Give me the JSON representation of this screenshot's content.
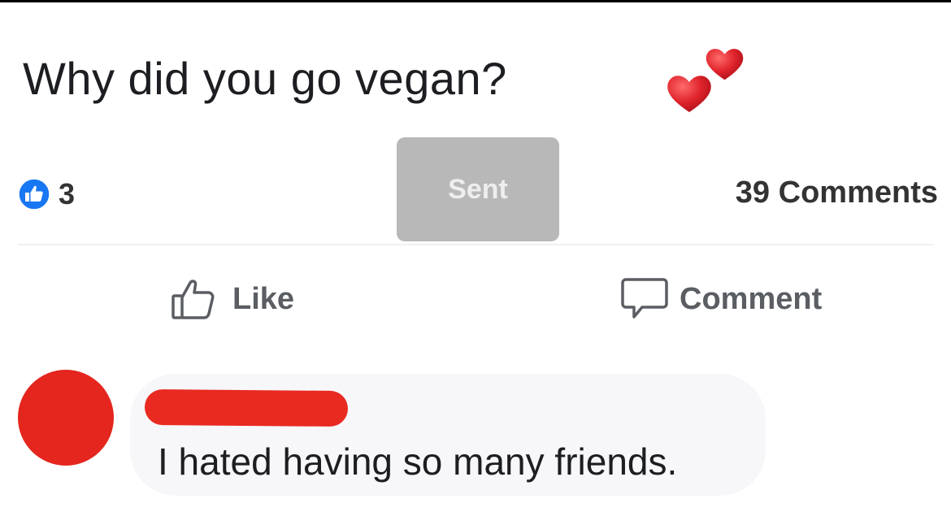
{
  "post": {
    "title": "Why did you go vegan?",
    "title_emoji": "two-hearts-icon"
  },
  "stats": {
    "reaction_icon": "like-icon",
    "reaction_count": "3",
    "comments_label": "39 Comments"
  },
  "overlay": {
    "sent_label": "Sent"
  },
  "actions": {
    "like_label": "Like",
    "comment_label": "Comment"
  },
  "comment": {
    "author_redacted": true,
    "text": "I hated having so many friends."
  },
  "colors": {
    "like_blue": "#1877f2",
    "heart_red": "#e0242c",
    "redaction_red": "#e82a21",
    "text_dark": "#1c1e21",
    "text_gray": "#5a5d62",
    "bubble_bg": "#f7f7fa",
    "sent_gray": "#b8b8b8"
  }
}
